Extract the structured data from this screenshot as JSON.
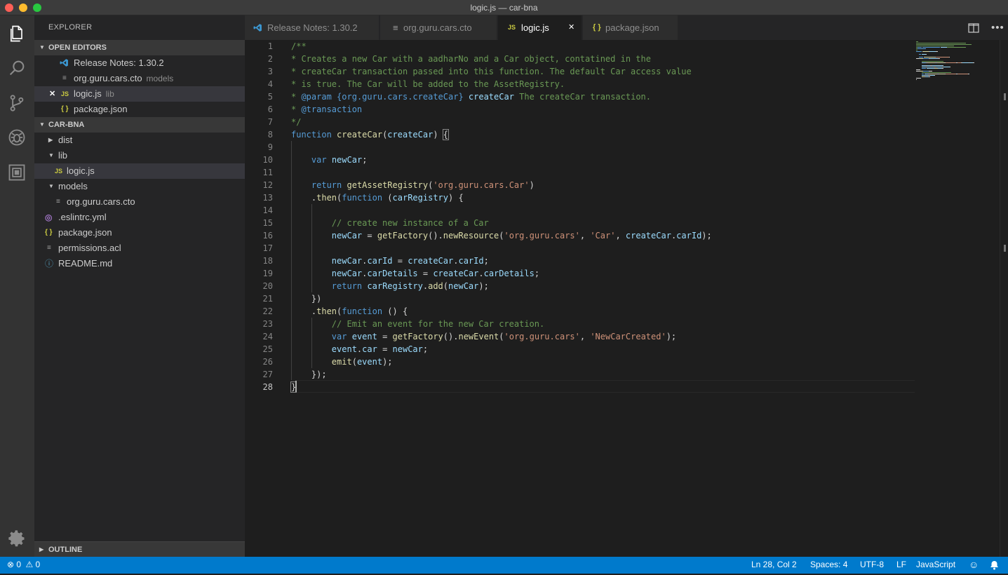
{
  "window": {
    "title": "logic.js — car-bna"
  },
  "activity_bar": {
    "items": [
      {
        "icon": "files-icon"
      },
      {
        "icon": "search-icon"
      },
      {
        "icon": "source-control-icon"
      },
      {
        "icon": "debug-icon"
      },
      {
        "icon": "extensions-icon"
      },
      {
        "icon": "gear-icon"
      }
    ]
  },
  "sidebar": {
    "header": "EXPLORER",
    "open_editors": {
      "title": "OPEN EDITORS",
      "items": [
        {
          "label": "Release Notes: 1.30.2",
          "desc": "",
          "icon": "vscode-icon"
        },
        {
          "label": "org.guru.cars.cto",
          "desc": "models",
          "icon": "file-lines-icon"
        },
        {
          "label": "logic.js",
          "desc": "lib",
          "icon": "js-icon",
          "icon_text": "JS",
          "close": "✕"
        },
        {
          "label": "package.json",
          "desc": "",
          "icon": "json-icon",
          "icon_text": "{ }"
        }
      ]
    },
    "project": {
      "title": "CAR-BNA",
      "items": [
        {
          "label": "dist"
        },
        {
          "label": "lib"
        },
        {
          "label": "logic.js",
          "icon_text": "JS"
        },
        {
          "label": "models"
        },
        {
          "label": "org.guru.cars.cto"
        },
        {
          "label": ".eslintrc.yml"
        },
        {
          "label": "package.json",
          "icon_text": "{ }"
        },
        {
          "label": "permissions.acl"
        },
        {
          "label": "README.md"
        }
      ]
    },
    "outline": "OUTLINE"
  },
  "tabs": [
    {
      "label": "Release Notes: 1.30.2",
      "icon": "vscode-icon"
    },
    {
      "label": "org.guru.cars.cto",
      "icon": "file-lines-icon"
    },
    {
      "label": "logic.js",
      "icon": "js-icon",
      "icon_text": "JS",
      "close": "✕",
      "active": true
    },
    {
      "label": "package.json",
      "icon": "json-icon",
      "icon_text": "{ }"
    }
  ],
  "editor": {
    "line_numbers": [
      "1",
      "2",
      "3",
      "4",
      "5",
      "6",
      "7",
      "8",
      "9",
      "10",
      "11",
      "12",
      "13",
      "14",
      "15",
      "16",
      "17",
      "18",
      "19",
      "20",
      "21",
      "22",
      "23",
      "24",
      "25",
      "26",
      "27",
      "28"
    ],
    "lines": [
      [
        [
          "/**",
          "c-com"
        ]
      ],
      [
        [
          "* Creates a new Car with a aadharNo and a Car object, contatined in the",
          "c-com"
        ]
      ],
      [
        [
          "* createCar transaction passed into this function. The default Car access value",
          "c-com"
        ]
      ],
      [
        [
          "* is true. The Car will be added to the AssetRegistry.",
          "c-com"
        ]
      ],
      [
        [
          "* ",
          "c-com"
        ],
        [
          "@param",
          "c-key"
        ],
        [
          " ",
          "c-com"
        ],
        [
          "{org.guru.cars.createCar}",
          "c-key"
        ],
        [
          " ",
          "c-com"
        ],
        [
          "createCar",
          "c-var"
        ],
        [
          " The createCar transaction.",
          "c-com"
        ]
      ],
      [
        [
          "* ",
          "c-com"
        ],
        [
          "@transaction",
          "c-key"
        ]
      ],
      [
        [
          "*/",
          "c-com"
        ]
      ],
      [
        [
          "function",
          "c-key"
        ],
        [
          " ",
          "c-pl"
        ],
        [
          "createCar",
          "c-fn"
        ],
        [
          "(",
          "c-pl"
        ],
        [
          "createCar",
          "c-var"
        ],
        [
          ") ",
          "c-pl"
        ],
        [
          "{",
          "c-pl bracket"
        ]
      ],
      [],
      [
        [
          "    ",
          "c-pl"
        ],
        [
          "var",
          "c-key"
        ],
        [
          " ",
          "c-pl"
        ],
        [
          "newCar",
          "c-var"
        ],
        [
          ";",
          "c-pl"
        ]
      ],
      [],
      [
        [
          "    ",
          "c-pl"
        ],
        [
          "return",
          "c-key"
        ],
        [
          " ",
          "c-pl"
        ],
        [
          "getAssetRegistry",
          "c-fn"
        ],
        [
          "(",
          "c-pl"
        ],
        [
          "'org.guru.cars.Car'",
          "c-str"
        ],
        [
          ")",
          "c-pl"
        ]
      ],
      [
        [
          "    .",
          "c-pl"
        ],
        [
          "then",
          "c-fn"
        ],
        [
          "(",
          "c-pl"
        ],
        [
          "function",
          "c-key"
        ],
        [
          " (",
          "c-pl"
        ],
        [
          "carRegistry",
          "c-var"
        ],
        [
          ") {",
          "c-pl"
        ]
      ],
      [],
      [
        [
          "        ",
          "c-pl"
        ],
        [
          "// create new instance of a Car",
          "c-com"
        ]
      ],
      [
        [
          "        ",
          "c-pl"
        ],
        [
          "newCar",
          "c-var"
        ],
        [
          " = ",
          "c-pl"
        ],
        [
          "getFactory",
          "c-fn"
        ],
        [
          "().",
          "c-pl"
        ],
        [
          "newResource",
          "c-fn"
        ],
        [
          "(",
          "c-pl"
        ],
        [
          "'org.guru.cars'",
          "c-str"
        ],
        [
          ", ",
          "c-pl"
        ],
        [
          "'Car'",
          "c-str"
        ],
        [
          ", ",
          "c-pl"
        ],
        [
          "createCar",
          "c-var"
        ],
        [
          ".",
          "c-pl"
        ],
        [
          "carId",
          "c-var"
        ],
        [
          ");",
          "c-pl"
        ]
      ],
      [],
      [
        [
          "        ",
          "c-pl"
        ],
        [
          "newCar",
          "c-var"
        ],
        [
          ".",
          "c-pl"
        ],
        [
          "carId",
          "c-var"
        ],
        [
          " = ",
          "c-pl"
        ],
        [
          "createCar",
          "c-var"
        ],
        [
          ".",
          "c-pl"
        ],
        [
          "carId",
          "c-var"
        ],
        [
          ";",
          "c-pl"
        ]
      ],
      [
        [
          "        ",
          "c-pl"
        ],
        [
          "newCar",
          "c-var"
        ],
        [
          ".",
          "c-pl"
        ],
        [
          "carDetails",
          "c-var"
        ],
        [
          " = ",
          "c-pl"
        ],
        [
          "createCar",
          "c-var"
        ],
        [
          ".",
          "c-pl"
        ],
        [
          "carDetails",
          "c-var"
        ],
        [
          ";",
          "c-pl"
        ]
      ],
      [
        [
          "        ",
          "c-pl"
        ],
        [
          "return",
          "c-key"
        ],
        [
          " ",
          "c-pl"
        ],
        [
          "carRegistry",
          "c-var"
        ],
        [
          ".",
          "c-pl"
        ],
        [
          "add",
          "c-fn"
        ],
        [
          "(",
          "c-pl"
        ],
        [
          "newCar",
          "c-var"
        ],
        [
          ");",
          "c-pl"
        ]
      ],
      [
        [
          "    })",
          "c-pl"
        ]
      ],
      [
        [
          "    .",
          "c-pl"
        ],
        [
          "then",
          "c-fn"
        ],
        [
          "(",
          "c-pl"
        ],
        [
          "function",
          "c-key"
        ],
        [
          " () {",
          "c-pl"
        ]
      ],
      [
        [
          "        ",
          "c-pl"
        ],
        [
          "// Emit an event for the new Car creation.",
          "c-com"
        ]
      ],
      [
        [
          "        ",
          "c-pl"
        ],
        [
          "var",
          "c-key"
        ],
        [
          " ",
          "c-pl"
        ],
        [
          "event",
          "c-var"
        ],
        [
          " = ",
          "c-pl"
        ],
        [
          "getFactory",
          "c-fn"
        ],
        [
          "().",
          "c-pl"
        ],
        [
          "newEvent",
          "c-fn"
        ],
        [
          "(",
          "c-pl"
        ],
        [
          "'org.guru.cars'",
          "c-str"
        ],
        [
          ", ",
          "c-pl"
        ],
        [
          "'NewCarCreated'",
          "c-str"
        ],
        [
          ");",
          "c-pl"
        ]
      ],
      [
        [
          "        ",
          "c-pl"
        ],
        [
          "event",
          "c-var"
        ],
        [
          ".",
          "c-pl"
        ],
        [
          "car",
          "c-var"
        ],
        [
          " = ",
          "c-pl"
        ],
        [
          "newCar",
          "c-var"
        ],
        [
          ";",
          "c-pl"
        ]
      ],
      [
        [
          "        ",
          "c-pl"
        ],
        [
          "emit",
          "c-fn"
        ],
        [
          "(",
          "c-pl"
        ],
        [
          "event",
          "c-var"
        ],
        [
          ");",
          "c-pl"
        ]
      ],
      [
        [
          "    });",
          "c-pl"
        ]
      ],
      [
        [
          "}",
          "c-pl bracket"
        ]
      ]
    ]
  },
  "status_bar": {
    "errors": "0",
    "warnings": "0",
    "position": "Ln 28, Col 2",
    "spaces": "Spaces: 4",
    "encoding": "UTF-8",
    "eol": "LF",
    "language": "JavaScript"
  },
  "colors": {
    "accent": "#007acc",
    "comment": "#6a9955",
    "keyword": "#569cd6",
    "function": "#dcdcaa",
    "variable": "#9cdcfe",
    "string": "#ce9178"
  }
}
